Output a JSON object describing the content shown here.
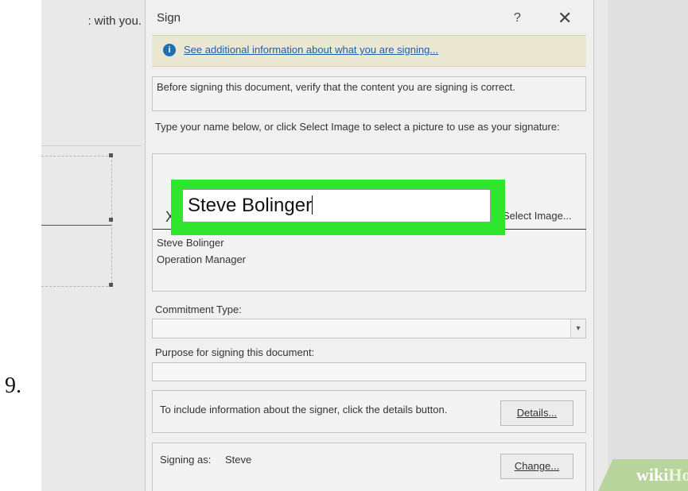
{
  "step_number": "9.",
  "document": {
    "text_fragment": ": with you."
  },
  "dialog": {
    "title": "Sign",
    "help_label": "?",
    "close_label": "✕",
    "info_link": "See additional information about what you are signing...",
    "verify_text": "Before signing this document, verify that the content you are signing is correct.",
    "instruction_text": "Type your name below, or click Select Image to select a picture to use as your signature:",
    "signature_value": "Steve Bolinger",
    "x_mark": "X",
    "select_image_label": "Select Image...",
    "signer_name": "Steve Bolinger",
    "signer_title": "Operation Manager",
    "commitment_label": "Commitment Type:",
    "commitment_value": "",
    "purpose_label": "Purpose for signing this document:",
    "purpose_value": "",
    "details_text": "To include information about the signer, click the details button.",
    "details_button": "Details...",
    "signing_as_label": "Signing as:",
    "signing_as_value": "Steve",
    "change_button": "Change..."
  },
  "watermark": {
    "wiki": "wiki",
    "how": "How"
  },
  "colors": {
    "highlight": "#2ee62e",
    "info_bar": "#eae7d2",
    "link": "#1f5fa8",
    "watermark_green": "#b9d49c"
  }
}
